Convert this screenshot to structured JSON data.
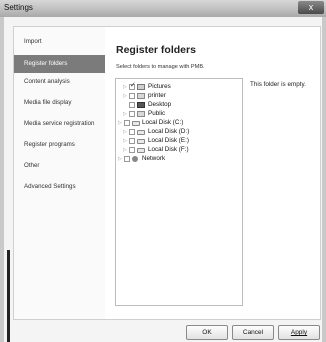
{
  "window": {
    "title": "Settings",
    "close_glyph": "x"
  },
  "sidebar": {
    "items": [
      {
        "label": "Import"
      },
      {
        "label": "Register folders"
      },
      {
        "label": "Content analysis"
      },
      {
        "label": "Media file display"
      },
      {
        "label": "Media service registration"
      },
      {
        "label": "Register programs"
      },
      {
        "label": "Other"
      },
      {
        "label": "Advanced Settings"
      }
    ],
    "active_index": 1
  },
  "main": {
    "heading": "Register folders",
    "instruction": "Select folders to manage with PMB.",
    "folder_status": "This folder is empty.",
    "tree": [
      {
        "label": "Pictures",
        "checked": true,
        "icon": "pictures-folder-icon"
      },
      {
        "label": "printer",
        "checked": false,
        "icon": "folder-icon"
      },
      {
        "label": "Desktop",
        "checked": false,
        "icon": "desktop-icon"
      },
      {
        "label": "Public",
        "checked": false,
        "icon": "folder-icon"
      },
      {
        "label": "Local Disk (C:)",
        "checked": false,
        "icon": "system-drive-icon"
      },
      {
        "label": "Local Disk (D:)",
        "checked": false,
        "icon": "drive-icon"
      },
      {
        "label": "Local Disk (E:)",
        "checked": false,
        "icon": "drive-icon"
      },
      {
        "label": "Local Disk (F:)",
        "checked": false,
        "icon": "drive-icon"
      },
      {
        "label": "Network",
        "checked": false,
        "icon": "network-icon"
      }
    ]
  },
  "buttons": {
    "ok": "OK",
    "cancel": "Cancel",
    "apply": "Apply"
  }
}
